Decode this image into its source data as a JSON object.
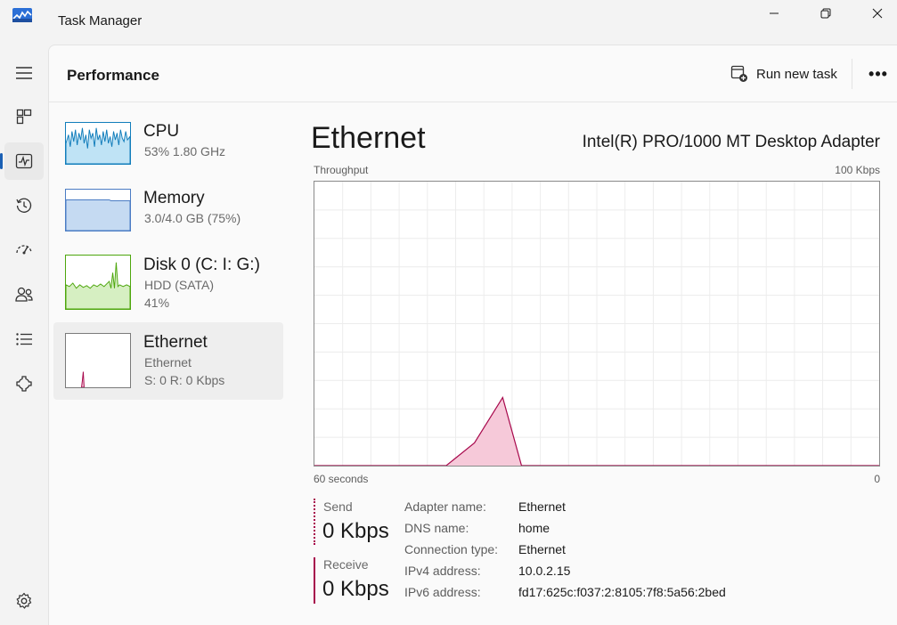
{
  "app": {
    "title": "Task Manager",
    "colors": {
      "accent": "#1a5fb4",
      "cpu": "#117dbb",
      "memory": "#8aa9d6",
      "disk": "#4da60c",
      "ethernet": "#a7074b"
    }
  },
  "titlebar_buttons": [
    "minimize-icon",
    "restore-icon",
    "close-icon"
  ],
  "nav": {
    "items": [
      {
        "name": "hamburger-menu-icon"
      },
      {
        "name": "processes-icon"
      },
      {
        "name": "performance-icon",
        "active": true
      },
      {
        "name": "app-history-icon"
      },
      {
        "name": "startup-apps-icon"
      },
      {
        "name": "users-icon"
      },
      {
        "name": "details-icon"
      },
      {
        "name": "services-icon"
      }
    ],
    "settings": "settings-icon"
  },
  "header": {
    "title": "Performance",
    "run_new_task": "Run new task",
    "more": "•••"
  },
  "sidebar": {
    "items": [
      {
        "name": "CPU",
        "sub1": "53%  1.80 GHz",
        "sub2": ""
      },
      {
        "name": "Memory",
        "sub1": "3.0/4.0 GB (75%)",
        "sub2": ""
      },
      {
        "name": "Disk 0 (C: I: G:)",
        "sub1": "HDD (SATA)",
        "sub2": "41%"
      },
      {
        "name": "Ethernet",
        "sub1": "Ethernet",
        "sub2": "S: 0 R: 0 Kbps",
        "selected": true
      }
    ]
  },
  "detail": {
    "title": "Ethernet",
    "adapter": "Intel(R) PRO/1000 MT Desktop Adapter",
    "throughput_label": "Throughput",
    "max_label": "100 Kbps",
    "time_label": "60 seconds",
    "min_label": "0",
    "send_label": "Send",
    "send_value": "0 Kbps",
    "receive_label": "Receive",
    "receive_value": "0 Kbps",
    "info": [
      {
        "key": "Adapter name:",
        "value": "Ethernet"
      },
      {
        "key": "DNS name:",
        "value": "home"
      },
      {
        "key": "Connection type:",
        "value": "Ethernet"
      },
      {
        "key": "IPv4 address:",
        "value": "10.0.2.15"
      },
      {
        "key": "IPv6 address:",
        "value": "fd17:625c:f037:2:8105:7f8:5a56:2bed"
      }
    ]
  },
  "chart_data": {
    "type": "area",
    "title": "Throughput",
    "xlabel": "60 seconds",
    "ylabel": "",
    "ylim": [
      0,
      100
    ],
    "x": [
      60,
      48,
      46,
      43,
      40,
      38,
      0
    ],
    "series": [
      {
        "values": [
          0,
          0,
          0,
          8,
          24,
          0,
          0
        ]
      }
    ]
  }
}
